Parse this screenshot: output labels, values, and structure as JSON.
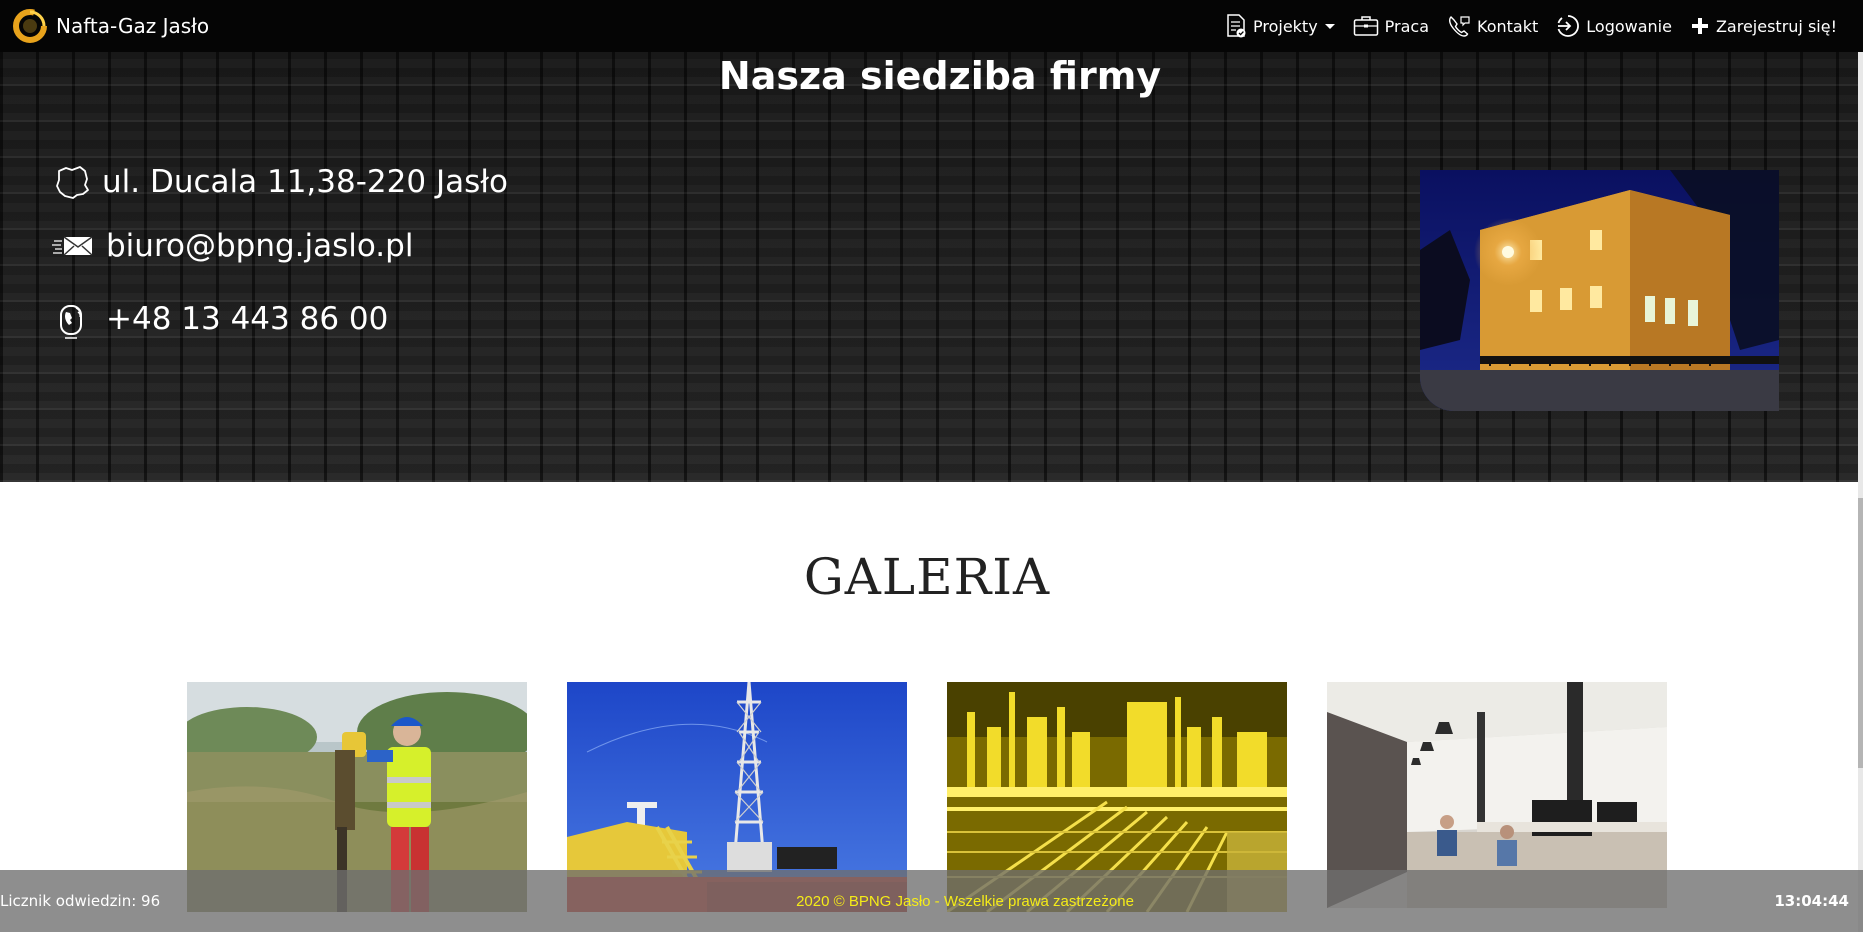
{
  "navbar": {
    "brand": "Nafta-Gaz Jasło",
    "items": [
      {
        "label": "Projekty",
        "icon": "document-check-icon",
        "dropdown": true
      },
      {
        "label": "Praca",
        "icon": "briefcase-icon"
      },
      {
        "label": "Kontakt",
        "icon": "phone-icon"
      },
      {
        "label": "Logowanie",
        "icon": "login-icon"
      },
      {
        "label": "Zarejestruj się!",
        "icon": "plus-icon"
      }
    ]
  },
  "headquarters": {
    "title": "Nasza siedziba firmy",
    "address": "ul. Ducala 11,38-220 Jasło",
    "email": "biuro@bpng.jaslo.pl",
    "phone": "+48 13 443 86 00"
  },
  "gallery": {
    "title": "GALERIA"
  },
  "footer": {
    "visit_counter": "Licznik odwiedzin: 96",
    "copyright": "2020 © BPNG Jasło - Wszelkie prawa zastrzeżone",
    "time": "13:04:44"
  },
  "colors": {
    "navbar_bg": "#050505",
    "footer_copyright": "#f5ec18",
    "brand_logo_accent": "#e8a31c"
  }
}
